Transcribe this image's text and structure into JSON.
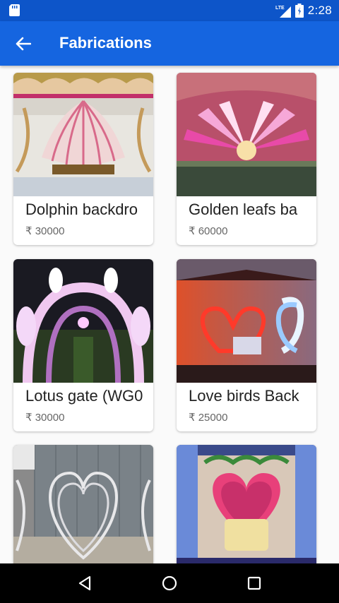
{
  "status_bar": {
    "time": "2:28",
    "network": "LTE",
    "icons": [
      "sd-card-icon",
      "signal-icon",
      "battery-icon"
    ]
  },
  "app_bar": {
    "title": "Fabrications",
    "back_icon": "arrow-back-icon"
  },
  "products": [
    {
      "name": "Dolphin backdro",
      "price": "₹ 30000"
    },
    {
      "name": "Golden leafs ba",
      "price": "₹ 60000"
    },
    {
      "name": "Lotus gate (WG0",
      "price": "₹ 30000"
    },
    {
      "name": "Love birds Back",
      "price": "₹ 25000"
    },
    {
      "name": "",
      "price": ""
    },
    {
      "name": "",
      "price": ""
    }
  ],
  "nav_bar": {
    "icons": [
      "back-triangle-icon",
      "home-circle-icon",
      "recents-square-icon"
    ]
  },
  "colors": {
    "status_bar": "#0d55c9",
    "app_bar": "#1565e0",
    "background": "#fafafa"
  }
}
